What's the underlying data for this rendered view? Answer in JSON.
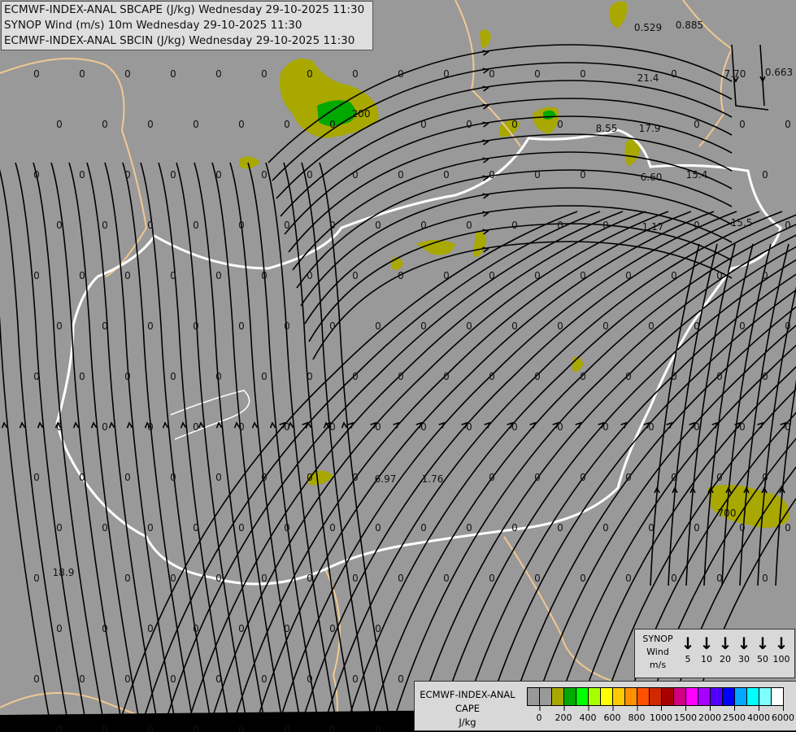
{
  "header": {
    "lines": [
      "ECMWF-INDEX-ANAL SBCAPE (J/kg) Wednesday 29-10-2025 11:30",
      "SYNOP Wind (m/s) 10m Wednesday 29-10-2025 11:30",
      "ECMWF-INDEX-ANAL SBCIN (J/kg) Wednesday 29-10-2025 11:30"
    ]
  },
  "map": {
    "zero_label": "0",
    "values": [
      "0.529",
      "0.885",
      "0.663",
      "7.70",
      "21.4",
      "8.55",
      "17.9",
      "6.60",
      "15.4",
      "15.5",
      "1.17",
      "6.97",
      "1.76",
      "18.9",
      "200",
      "700"
    ],
    "colors": {
      "background": "#999999",
      "cape_low": "#a8a800",
      "cape_mid": "#00a800",
      "border_country": "#ffffff",
      "border_region": "#f0c890",
      "river": "#4070c0"
    }
  },
  "synop_legend": {
    "title_lines": [
      "SYNOP",
      "Wind",
      "m/s"
    ],
    "speeds": [
      "5",
      "10",
      "20",
      "30",
      "50",
      "100"
    ]
  },
  "cape_legend": {
    "title_lines": [
      "ECMWF-INDEX-ANAL",
      "CAPE",
      "J/kg"
    ],
    "colors": [
      "#999999",
      "#999999",
      "#a8a800",
      "#00a800",
      "#00ff00",
      "#a8ff00",
      "#ffff00",
      "#ffc800",
      "#ff9000",
      "#ff5000",
      "#d02800",
      "#a80000",
      "#d00080",
      "#ff00ff",
      "#a800ff",
      "#5000ff",
      "#0000ff",
      "#00a8ff",
      "#00ffff",
      "#80ffff",
      "#ffffff"
    ],
    "ticks": [
      "0",
      "200",
      "400",
      "600",
      "800",
      "1000",
      "1500",
      "2000",
      "2500",
      "4000",
      "6000"
    ]
  }
}
